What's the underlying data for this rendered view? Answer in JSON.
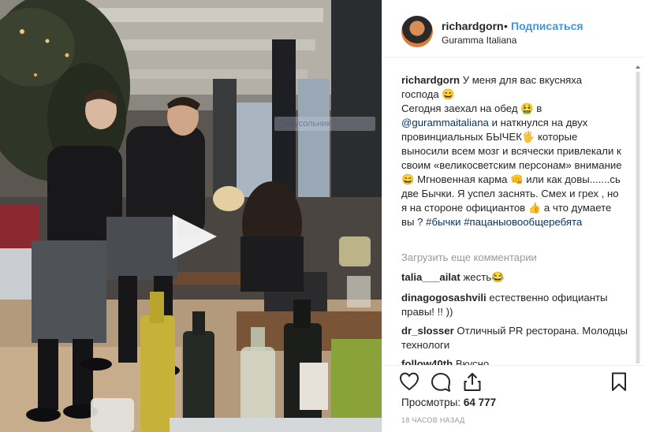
{
  "header": {
    "username": "richardgorn",
    "separator": "•",
    "follow_label": "Подписаться",
    "location": "Guramma Italiana"
  },
  "media": {
    "watermark": "Гамусольник"
  },
  "caption": {
    "username": "richardgorn",
    "line1": "У меня для вас вкусняха господа 😄",
    "line2a": "Сегодня заехал на обед 🤮 в",
    "mention": "@gurammaitaliana",
    "line2b": "и наткнулся на двух провинциальных БЫЧЕК🖐 которые выносили всем мозг и всячески привлекали к своим «великосветским персонам» внимание 😄 Мгновенная карма 👊 или как довы.......сь две Бычки. Я успел заснять. Смех и грех , но я на стороне официантов 👍 а что думаете вы ?",
    "hashtag1": "#бычки",
    "hashtag2": "#пацаныовообщеребята"
  },
  "load_more": "Загрузить еще комментарии",
  "comments": [
    {
      "user": "talia___ailat",
      "text": "жесть😂"
    },
    {
      "user": "dinagogosashvili",
      "text": "естественно официанты правы! !! ))"
    },
    {
      "user": "dr_slosser",
      "text": "Отличный PR ресторана. Молодцы технологи"
    },
    {
      "user": "follow40th",
      "text": "Вкусно"
    }
  ],
  "icons": {
    "like": "heart-icon",
    "comment": "comment-icon",
    "share": "share-icon",
    "save": "bookmark-icon",
    "play": "play-icon"
  },
  "views_label": "Просмотры:",
  "views_count": "64 777",
  "timestamp": "18 ЧАСОВ НАЗАД",
  "colors": {
    "accent": "#3897f0",
    "mention": "#003569",
    "muted": "#999999",
    "border": "#efefef"
  }
}
